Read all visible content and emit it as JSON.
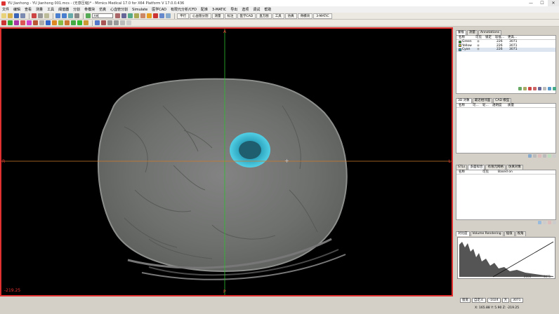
{
  "window": {
    "title": "YU Jianhong - YU Jianhong 001.mcs - (无感压缩)* - Mimics Medical 17.0 for X64 Platform V 17.0.0.436",
    "buttons": [
      "—",
      "☐",
      "✕"
    ]
  },
  "menu": [
    "文件",
    "编辑",
    "查看",
    "测量",
    "工具",
    "阈值器",
    "分割",
    "骨模块",
    "仿真",
    "心血管分割",
    "Simulate",
    "医学CAD",
    "有限元分析/CFD",
    "配准",
    "3-MATIC",
    "导出",
    "选项",
    "调试",
    "帮助"
  ],
  "toolbar": {
    "view_select": "方框",
    "tabs": [
      "平行",
      "心血管分割",
      "测量",
      "标注",
      "医学CAD",
      "直方图",
      "工具",
      "仿真",
      "骨模块",
      "3-MATIC"
    ]
  },
  "viewport": {
    "orientation": {
      "top": "A",
      "bottom": "P",
      "left": "R",
      "right": "L"
    },
    "slice_position": "-219.25"
  },
  "panels": {
    "masks": {
      "tabs": [
        "蒙板",
        "测量",
        "Annotations"
      ],
      "columns": [
        "名称",
        "可见",
        "锁定",
        "较低...",
        "更高..."
      ],
      "rows": [
        {
          "name": "Green",
          "color": "#22b022",
          "min": "226",
          "max": "3071"
        },
        {
          "name": "Yellow",
          "color": "#e6d81a",
          "min": "226",
          "max": "3071"
        },
        {
          "name": "Cyan",
          "color": "#18c8d0",
          "min": "226",
          "max": "3071"
        }
      ]
    },
    "objects3d": {
      "tabs": [
        "3D 对象",
        "最近相邻面",
        "CAD 模型"
      ],
      "columns": [
        "名称",
        "可...",
        "轮...",
        "透明度",
        "质量"
      ]
    },
    "stl": {
      "tabs": [
        "STLs",
        "多面拟合",
        "有限元网格",
        "仿真对象"
      ],
      "columns": [
        "名称",
        "可见",
        "Based on"
      ]
    },
    "contrast": {
      "tabs": [
        "对比度",
        "Volume Rendering",
        "插值",
        "视角"
      ],
      "histogram_max": "3071",
      "histogram_mid": "2000"
    }
  },
  "status": {
    "fields": [
      "窗宽",
      "自定义",
      "-1024",
      "大",
      "3071"
    ],
    "coords": "X: 165.88  Y: 5.90  Z: -219.25"
  }
}
